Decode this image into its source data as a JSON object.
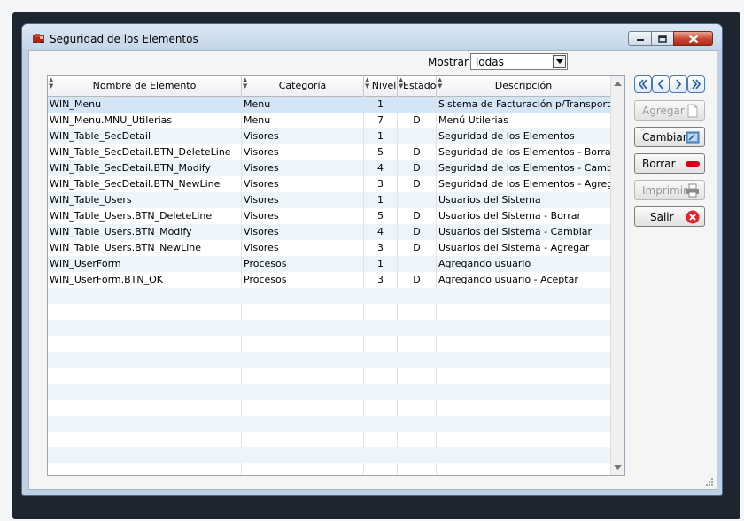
{
  "window": {
    "title": "Seguridad de los Elementos",
    "app_icon": "app-icon"
  },
  "filter": {
    "label": "Mostrar",
    "selected": "Todas"
  },
  "grid": {
    "columns": [
      "Nombre de Elemento",
      "Categoría",
      "Nivel",
      "Estado",
      "Descripción"
    ],
    "rows": [
      [
        "WIN_Menu",
        "Menu",
        "1",
        "",
        "Sistema de Facturación p/Transporte"
      ],
      [
        "WIN_Menu.MNU_Utilerias",
        "Menu",
        "7",
        "D",
        "Menú Utilerias"
      ],
      [
        "WIN_Table_SecDetail",
        "Visores",
        "1",
        "",
        "Seguridad de los Elementos"
      ],
      [
        "WIN_Table_SecDetail.BTN_DeleteLine",
        "Visores",
        "5",
        "D",
        "Seguridad de los Elementos - Borrar"
      ],
      [
        "WIN_Table_SecDetail.BTN_Modify",
        "Visores",
        "4",
        "D",
        "Seguridad de los Elementos - Cambiar"
      ],
      [
        "WIN_Table_SecDetail.BTN_NewLine",
        "Visores",
        "3",
        "D",
        "Seguridad de los Elementos - Agregar"
      ],
      [
        "WIN_Table_Users",
        "Visores",
        "1",
        "",
        "Usuarios del Sistema"
      ],
      [
        "WIN_Table_Users.BTN_DeleteLine",
        "Visores",
        "5",
        "D",
        "Usuarios del Sistema - Borrar"
      ],
      [
        "WIN_Table_Users.BTN_Modify",
        "Visores",
        "4",
        "D",
        "Usuarios del Sistema - Cambiar"
      ],
      [
        "WIN_Table_Users.BTN_NewLine",
        "Visores",
        "3",
        "D",
        "Usuarios del Sistema - Agregar"
      ],
      [
        "WIN_UserForm",
        "Procesos",
        "1",
        "",
        "Agregando usuario"
      ],
      [
        "WIN_UserForm.BTN_OK",
        "Procesos",
        "3",
        "D",
        "Agregando usuario - Aceptar"
      ]
    ],
    "selected_row": 0
  },
  "actions": {
    "add": "Agregar",
    "modify": "Cambiar",
    "delete": "Borrar",
    "print": "Imprimir",
    "exit": "Salir"
  },
  "colors": {
    "row_alt": "#eef4fb",
    "row_selected": "#d4e6f6",
    "delete_red": "#d9001b",
    "exit_red": "#e0262d",
    "nav_blue": "#4d78b6"
  }
}
